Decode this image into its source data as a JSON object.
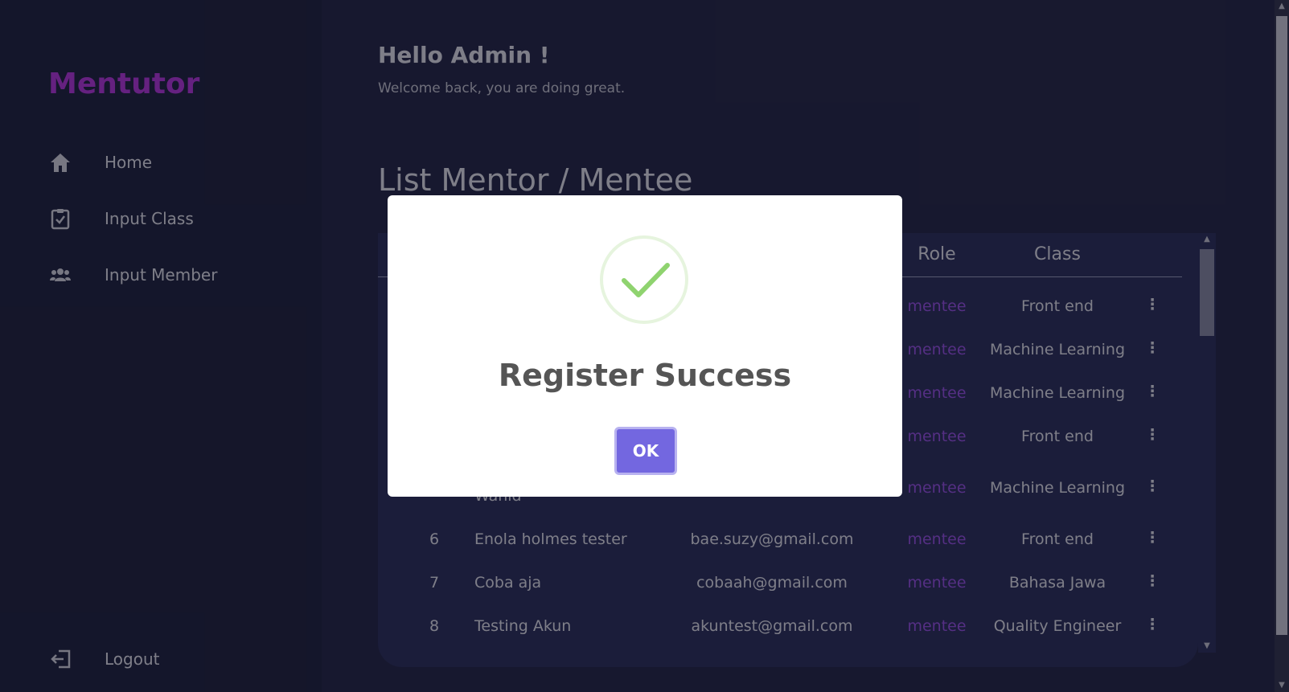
{
  "sidebar": {
    "logo": "Mentutor",
    "items": [
      {
        "label": "Home",
        "icon": "home-icon"
      },
      {
        "label": "Input Class",
        "icon": "clipboard-check-icon"
      },
      {
        "label": "Input Member",
        "icon": "users-icon"
      }
    ],
    "logout": {
      "label": "Logout",
      "icon": "logout-icon"
    }
  },
  "header": {
    "greeting": "Hello Admin !",
    "subtitle": "Welcome back, you are doing great."
  },
  "list": {
    "title": "List Mentor / Mentee",
    "columns": {
      "role": "Role",
      "class": "Class"
    },
    "rows": [
      {
        "no": "",
        "name": "",
        "email": "",
        "role": "mentee",
        "class": "Front end"
      },
      {
        "no": "",
        "name": "",
        "email": "",
        "role": "mentee",
        "class": "Machine Learning"
      },
      {
        "no": "",
        "name": "",
        "email": "",
        "role": "mentee",
        "class": "Machine Learning"
      },
      {
        "no": "",
        "name": "",
        "email": "",
        "role": "mentee",
        "class": "Front end"
      },
      {
        "no": "",
        "name": "Wahid",
        "email": "",
        "role": "mentee",
        "class": "Machine Learning"
      },
      {
        "no": "6",
        "name": "Enola holmes tester",
        "email": "bae.suzy@gmail.com",
        "role": "mentee",
        "class": "Front end"
      },
      {
        "no": "7",
        "name": "Coba aja",
        "email": "cobaah@gmail.com",
        "role": "mentee",
        "class": "Bahasa Jawa"
      },
      {
        "no": "8",
        "name": "Testing Akun",
        "email": "akuntest@gmail.com",
        "role": "mentee",
        "class": "Quality Engineer"
      }
    ],
    "row_menu_symbol": "⋮"
  },
  "modal": {
    "title": "Register Success",
    "ok_label": "OK",
    "icon": "success-check-icon"
  },
  "scroll": {
    "up": "▲",
    "down": "▼"
  },
  "colors": {
    "brand": "#b93ce0",
    "role": "#9b57e8",
    "ok_button": "#7367e0",
    "check": "#8fd36f"
  }
}
